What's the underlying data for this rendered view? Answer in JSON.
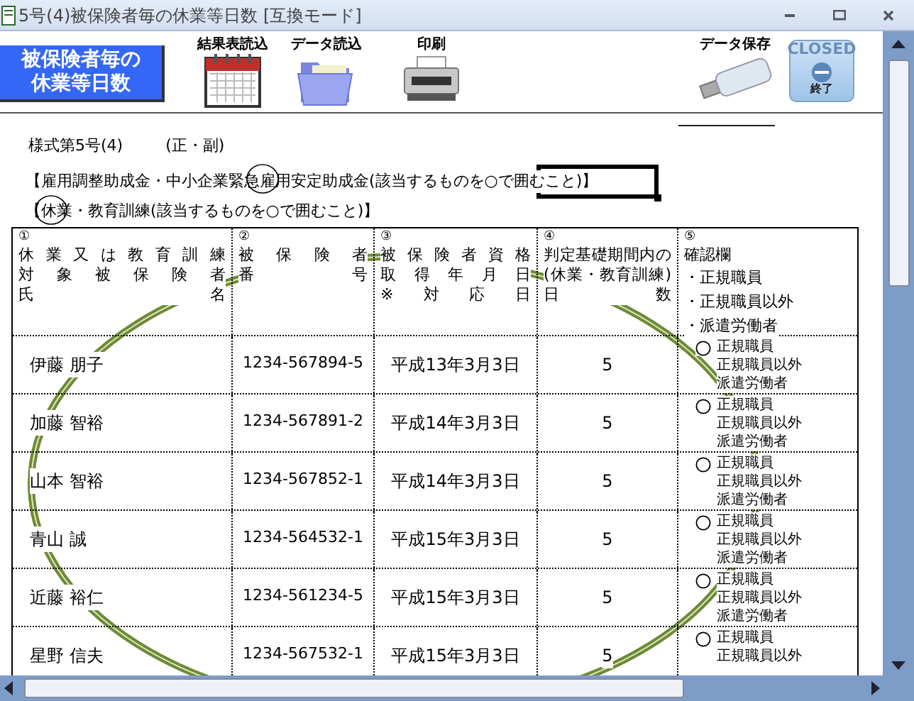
{
  "window": {
    "title": "5号(4)被保険者毎の休業等日数 [互換モード]"
  },
  "banner": {
    "lines": [
      "被保険者毎の",
      "休業等日数"
    ]
  },
  "toolbar": [
    {
      "kind": "calendar",
      "label": "結果表読込"
    },
    {
      "kind": "folder",
      "label": "データ読込"
    },
    {
      "kind": "printer",
      "label": "印刷"
    },
    {
      "kind": "usb",
      "label": "データ保存"
    },
    {
      "kind": "closed",
      "label": "CLOSED",
      "sublabel": "終了"
    }
  ],
  "sheet": {
    "form_number": "様式第5号(4)",
    "copy_type": "(正・副)",
    "subsidy_line": "【雇用調整助成金・中小企業緊急雇用安定助成金(該当するものを○で囲むこと)】",
    "leave_line": "【休業・教育訓練(該当するものを○で囲むこと)】",
    "columns": [
      {
        "number": "①",
        "lines": [
          "休業又は教育訓練",
          "対象被保険者",
          "氏名"
        ]
      },
      {
        "number": "②",
        "lines": [
          "被保険者",
          "番号"
        ]
      },
      {
        "number": "③",
        "lines": [
          "被保険者資格",
          "取得年月日",
          "※対応日"
        ]
      },
      {
        "number": "④",
        "lines": [
          "判定基礎期間内の",
          "(休業・教育訓練)",
          "日数"
        ]
      },
      {
        "number": "⑤",
        "title": "確認欄",
        "lines": [
          "・正規職員",
          "・正規職員以外",
          "・派遣労働者"
        ]
      }
    ],
    "rows": [
      {
        "name": "伊藤 朋子",
        "number": "1234-567894-5",
        "date": "平成13年3月3日",
        "days": "5",
        "options": [
          "正規職員",
          "正規職員以外",
          "派遣労働者"
        ]
      },
      {
        "name": "加藤 智裕",
        "number": "1234-567891-2",
        "date": "平成14年3月3日",
        "days": "5",
        "options": [
          "正規職員",
          "正規職員以外",
          "派遣労働者"
        ]
      },
      {
        "name": "山本 智裕",
        "number": "1234-567852-1",
        "date": "平成14年3月3日",
        "days": "5",
        "options": [
          "正規職員",
          "正規職員以外",
          "派遣労働者"
        ]
      },
      {
        "name": "青山 誠",
        "number": "1234-564532-1",
        "date": "平成15年3月3日",
        "days": "5",
        "options": [
          "正規職員",
          "正規職員以外",
          "派遣労働者"
        ]
      },
      {
        "name": "近藤 裕仁",
        "number": "1234-561234-5",
        "date": "平成15年3月3日",
        "days": "5",
        "options": [
          "正規職員",
          "正規職員以外",
          "派遣労働者"
        ]
      },
      {
        "name": "星野 信夫",
        "number": "1234-567532-1",
        "date": "平成15年3月3日",
        "days": "5",
        "options": [
          "正規職員",
          "正規職員以外"
        ]
      }
    ]
  }
}
